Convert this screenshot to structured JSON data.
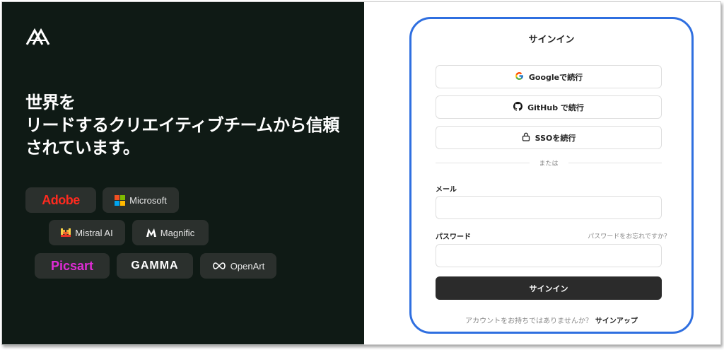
{
  "hero": {
    "line1": "世界を",
    "line2": "リードするクリエイティブチームから信頼",
    "line3": "されています。"
  },
  "logos": {
    "adobe": "Adobe",
    "microsoft": "Microsoft",
    "mistral": "Mistral AI",
    "magnific": "Magnific",
    "picsart": "Picsart",
    "gamma": "GAMMA",
    "openart": "OpenArt"
  },
  "signin": {
    "title": "サインイン",
    "google_label": "Googleで続行",
    "github_label": "GitHub で続行",
    "sso_label": "SSOを続行",
    "divider_text": "または",
    "email_label": "メール",
    "email_value": "",
    "password_label": "パスワード",
    "password_value": "",
    "forgot_label": "パスワードをお忘れですか？",
    "submit_label": "サインイン",
    "no_account_text": "アカウントをお持ちではありませんか？",
    "signup_label": "サインアップ"
  },
  "colors": {
    "left_bg": "#0f1a15",
    "chip_bg": "#2b302d",
    "card_border": "#2f6fe0",
    "adobe_red": "#ff2a1f",
    "picsart_pink": "#e02bd6",
    "primary_button": "#2b2b2b"
  }
}
